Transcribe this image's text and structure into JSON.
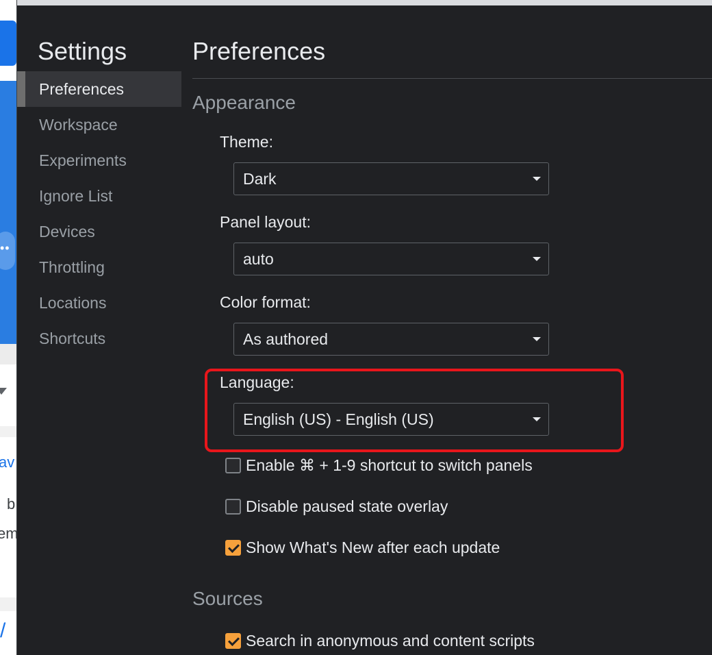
{
  "background_page": {
    "snippets": [
      "av",
      "b",
      "em",
      "/"
    ]
  },
  "sidebar": {
    "title": "Settings",
    "items": [
      {
        "label": "Preferences",
        "active": true
      },
      {
        "label": "Workspace",
        "active": false
      },
      {
        "label": "Experiments",
        "active": false
      },
      {
        "label": "Ignore List",
        "active": false
      },
      {
        "label": "Devices",
        "active": false
      },
      {
        "label": "Throttling",
        "active": false
      },
      {
        "label": "Locations",
        "active": false
      },
      {
        "label": "Shortcuts",
        "active": false
      }
    ]
  },
  "main": {
    "title": "Preferences",
    "appearance": {
      "heading": "Appearance",
      "theme": {
        "label": "Theme:",
        "value": "Dark"
      },
      "panel_layout": {
        "label": "Panel layout:",
        "value": "auto"
      },
      "color_format": {
        "label": "Color format:",
        "value": "As authored"
      },
      "language": {
        "label": "Language:",
        "value": "English (US) - English (US)"
      },
      "checkboxes": [
        {
          "label": "Enable ⌘ + 1-9 shortcut to switch panels",
          "checked": false
        },
        {
          "label": "Disable paused state overlay",
          "checked": false
        },
        {
          "label": "Show What's New after each update",
          "checked": true
        }
      ]
    },
    "sources": {
      "heading": "Sources",
      "checkboxes": [
        {
          "label": "Search in anonymous and content scripts",
          "checked": true
        }
      ]
    }
  },
  "colors": {
    "background": "#202124",
    "accent_checkbox": "#f6a13c",
    "highlight_outline": "#e8161b"
  }
}
